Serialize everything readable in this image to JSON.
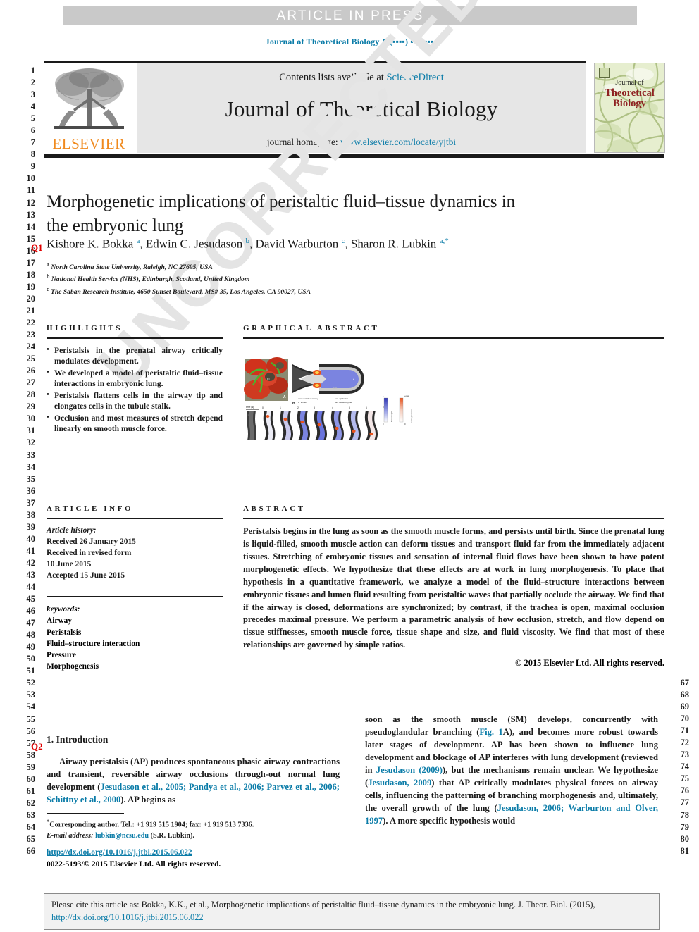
{
  "header": {
    "article_in_press": "ARTICLE IN PRESS",
    "running_head_prefix": "Journal of Theoretical Biology",
    "running_head_suffix": "(▪▪▪▪) ▪▪▪–▪▪▪"
  },
  "masthead": {
    "contents_text": "Contents lists available at",
    "sciencedirect": "ScienceDirect",
    "journal_title": "Journal of Theoretical Biology",
    "homepage_label": "journal homepage:",
    "homepage_url": "www.elsevier.com/locate/yjtbi",
    "elsevier_wordmark": "ELSEVIER",
    "elsevier_color": "#f08a1e",
    "cover": {
      "line1": "Journal of",
      "line2": "Theoretical",
      "line3": "Biology",
      "title_color": "#8f2222"
    },
    "link_color": "#0b7ca8"
  },
  "watermark": {
    "text": "UNCORRECTED PROOF"
  },
  "line_numbers": {
    "left_start": 1,
    "left_end": 66,
    "right_start": 67,
    "right_end": 81,
    "query_markers": [
      {
        "label": "Q1",
        "line": 15
      },
      {
        "label": "Q2",
        "line": 56
      }
    ],
    "marker_color": "#e00000"
  },
  "article": {
    "title": "Morphogenetic implications of peristaltic fluid–tissue dynamics in the embryonic lung",
    "authors_html": "Kishore K. Bokka <sup>a</sup>, Edwin C. Jesudason <sup>b</sup>, David Warburton <sup>c</sup>, Sharon R. Lubkin <sup>a,*</sup>",
    "affiliations": [
      {
        "mark": "a",
        "text": "North Carolina State University, Raleigh, NC 27695, USA"
      },
      {
        "mark": "b",
        "text": "National Health Service (NHS), Edinburgh, Scotland, United Kingdom"
      },
      {
        "mark": "c",
        "text": "The Saban Research Institute, 4650 Sunset Boulevard, MS# 35, Los Angeles, CA 90027, USA"
      }
    ]
  },
  "highlights": {
    "heading": "HIGHLIGHTS",
    "items": [
      "Peristalsis in the prenatal airway critically modulates development.",
      "We developed a model of peristaltic fluid–tissue interactions in embryonic lung.",
      "Peristalsis flattens cells in the airway tip and elongates cells in the tubule stalk.",
      "Occlusion and most measures of stretch depend linearly on smooth muscle force."
    ]
  },
  "graphical_abstract": {
    "heading": "GRAPHICAL ABSTRACT",
    "panels": [
      {
        "label": "A",
        "type": "fluorescence-micrograph"
      },
      {
        "label": "B",
        "type": "schematic-tube"
      },
      {
        "label": "C",
        "type": "time-series"
      }
    ],
    "panel_b_captions": [
      "non-occluded airway\n1° lumen",
      "non-epithelial\ndiff. mesenchyme"
    ],
    "panel_c_axis_label": "time (s)",
    "panel_c_ticks": [
      "0",
      "1",
      "2",
      "3",
      "4",
      "5",
      "6",
      "7"
    ],
    "colorbars": [
      {
        "label": "lumen pressure",
        "max": "+max",
        "min": "0"
      },
      {
        "label": "flow rate (%)",
        "ticks": [
          "4",
          "3",
          "2",
          "1",
          "0"
        ]
      }
    ]
  },
  "article_info": {
    "heading": "ARTICLE INFO",
    "history_label": "Article history:",
    "history": [
      "Received 26 January 2015",
      "Received in revised form",
      "10 June 2015",
      "Accepted 15 June 2015"
    ],
    "keywords_label": "keywords:",
    "keywords": [
      "Airway",
      "Peristalsis",
      "Fluid–structure interaction",
      "Pressure",
      "Morphogenesis"
    ]
  },
  "abstract": {
    "heading": "ABSTRACT",
    "text": "Peristalsis begins in the lung as soon as the smooth muscle forms, and persists until birth. Since the prenatal lung is liquid-filled, smooth muscle action can deform tissues and transport fluid far from the immediately adjacent tissues. Stretching of embryonic tissues and sensation of internal fluid flows have been shown to have potent morphogenetic effects. We hypothesize that these effects are at work in lung morphogenesis. To place that hypothesis in a quantitative framework, we analyze a model of the fluid–structure interactions between embryonic tissues and lumen fluid resulting from peristaltic waves that partially occlude the airway. We find that if the airway is closed, deformations are synchronized; by contrast, if the trachea is open, maximal occlusion precedes maximal pressure. We perform a parametric analysis of how occlusion, stretch, and flow depend on tissue stiffnesses, smooth muscle force, tissue shape and size, and fluid viscosity. We find that most of these relationships are governed by simple ratios.",
    "copyright": "© 2015 Elsevier Ltd. All rights reserved."
  },
  "introduction": {
    "heading": "1. Introduction",
    "col1_html": "Airway peristalsis (AP) produces spontaneous phasic airway contractions and transient, reversible airway occlusions through-out normal lung development (<span class=\"ref\">Jesudason et al., 2005; Pandya et al., 2006; Parvez et al., 2006; Schittny et al., 2000</span>). AP begins as",
    "col2_html": "soon as the smooth muscle (SM) develops, concurrently with pseudoglandular branching (<span class=\"ref\">Fig. 1</span>A), and becomes more robust towards later stages of development. AP has been shown to influence lung development and blockage of AP interferes with lung development (reviewed in <span class=\"ref\">Jesudason (2009)</span>), but the mechanisms remain unclear. We hypothesize (<span class=\"ref\">Jesudason, 2009</span>) that AP critically modulates physical forces on airway cells, influencing the patterning of branching morphogenesis and, ultimately, the overall growth of the lung (<span class=\"ref\">Jesudason, 2006; Warburton and Olver, 1997</span>). A more specific hypothesis would"
  },
  "footnote": {
    "corresponding_html": "<sup>*</sup>Corresponding author. Tel.: +1 919 515 1904; fax: +1 919 513 7336.",
    "email_label": "E-mail address:",
    "email": "lubkin@ncsu.edu",
    "email_suffix": "(S.R. Lubkin).",
    "doi_url": "http://dx.doi.org/10.1016/j.jtbi.2015.06.022",
    "issn_line": "0022-5193/© 2015 Elsevier Ltd. All rights reserved."
  },
  "cite_box": {
    "prefix": "Please cite this article as: Bokka, K.K., et al., Morphogenetic implications of peristaltic fluid–tissue dynamics in the embryonic lung. J. Theor. Biol. (2015),",
    "doi": "http://dx.doi.org/10.1016/j.jtbi.2015.06.022"
  }
}
